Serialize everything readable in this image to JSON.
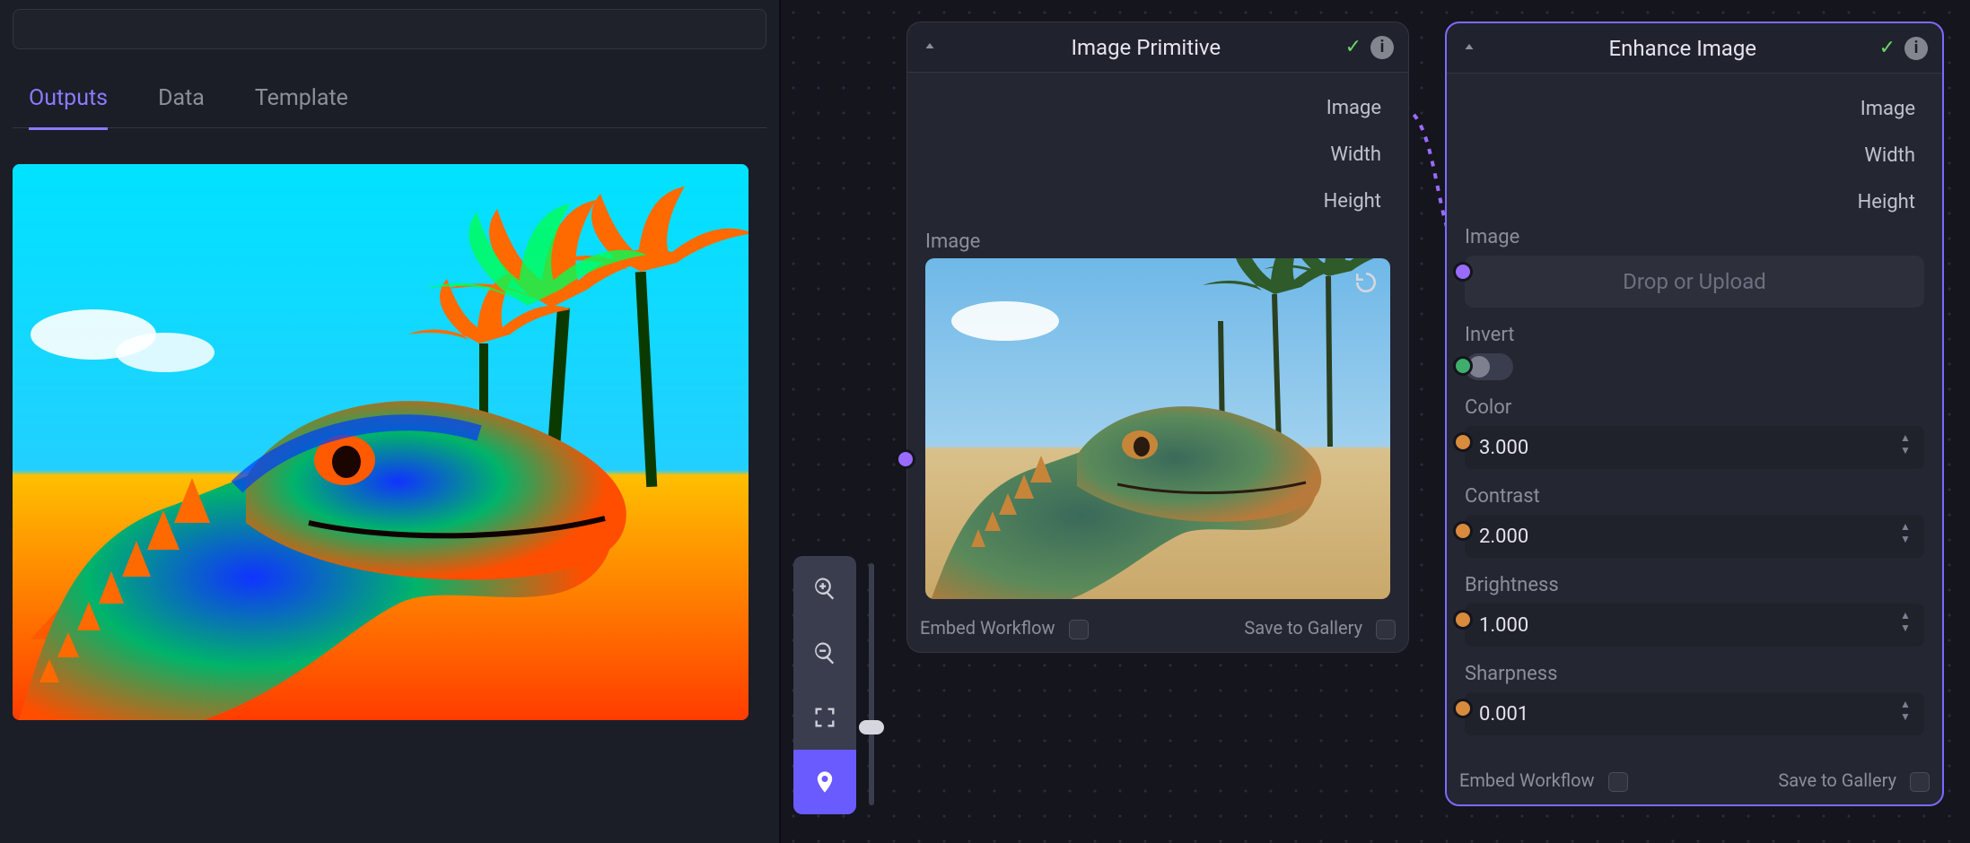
{
  "tabs": {
    "outputs": "Outputs",
    "data": "Data",
    "template": "Template"
  },
  "canvas_tools": {
    "zoom_in": "zoom-in",
    "zoom_out": "zoom-out",
    "fit": "fit-screen",
    "pin": "location-pin"
  },
  "node_primitive": {
    "title": "Image Primitive",
    "outputs": {
      "image": "Image",
      "width": "Width",
      "height": "Height"
    },
    "image_label": "Image",
    "footer": {
      "embed": "Embed Workflow",
      "save": "Save to Gallery"
    }
  },
  "node_enhance": {
    "title": "Enhance Image",
    "outputs": {
      "image": "Image",
      "width": "Width",
      "height": "Height"
    },
    "fields": {
      "image_label": "Image",
      "drop_text": "Drop or Upload",
      "invert_label": "Invert",
      "color_label": "Color",
      "color_value": "3.000",
      "contrast_label": "Contrast",
      "contrast_value": "2.000",
      "brightness_label": "Brightness",
      "brightness_value": "1.000",
      "sharpness_label": "Sharpness",
      "sharpness_value": "0.001"
    },
    "footer": {
      "embed": "Embed Workflow",
      "save": "Save to Gallery"
    }
  }
}
